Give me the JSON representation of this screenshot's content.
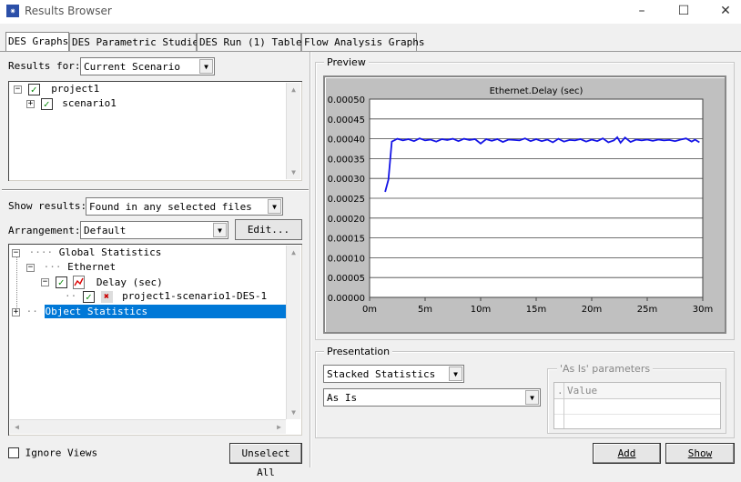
{
  "window": {
    "title": "Results Browser",
    "icon": "star-icon",
    "min": "–",
    "max": "☐",
    "close": "✕"
  },
  "tabs": [
    {
      "label": "DES Graphs"
    },
    {
      "label": "DES Parametric Studies"
    },
    {
      "label": "DES Run (1) Tables"
    },
    {
      "label": "Flow Analysis Graphs"
    }
  ],
  "results_for": {
    "label": "Results for:",
    "value": "Current Scenario"
  },
  "file_tree": [
    {
      "label": "project1",
      "checked": true
    },
    {
      "label": "scenario1",
      "checked": true
    }
  ],
  "show_results": {
    "label": "Show results:",
    "value": "Found in any selected files"
  },
  "arrangement": {
    "label": "Arrangement:",
    "value": "Default",
    "edit_button": "Edit..."
  },
  "stats_tree": [
    {
      "label": "Global Statistics"
    },
    {
      "label": "Ethernet"
    },
    {
      "label": "Delay (sec)"
    },
    {
      "label": "project1-scenario1-DES-1"
    },
    {
      "label": "Object Statistics"
    }
  ],
  "ignore_views": {
    "label": "Ignore Views",
    "checked": false
  },
  "unselect_all": "Unselect All",
  "preview": {
    "title": "Preview"
  },
  "presentation": {
    "title": "Presentation",
    "mode": "Stacked Statistics",
    "filter": "As Is",
    "params_title": "'As Is' parameters",
    "params_header_dot": ".",
    "params_header_value": "Value"
  },
  "buttons": {
    "add": "Add",
    "show": "Show"
  },
  "colors": {
    "accent": "#0078d7",
    "series": "#1414e6",
    "selection": "#0078d7"
  },
  "chart_data": {
    "type": "line",
    "title": "Ethernet.Delay (sec)",
    "xlabel": "",
    "ylabel": "",
    "x_unit": "minutes",
    "xlim": [
      0,
      30
    ],
    "ylim": [
      0,
      0.0005
    ],
    "yticks": [
      "0.00000",
      "0.00005",
      "0.00010",
      "0.00015",
      "0.00020",
      "0.00025",
      "0.00030",
      "0.00035",
      "0.00040",
      "0.00045",
      "0.00050"
    ],
    "xticks": [
      "0m",
      "5m",
      "10m",
      "15m",
      "20m",
      "25m",
      "30m"
    ],
    "grid": true,
    "series": [
      {
        "values": [
          [
            1.4,
            0.000266
          ],
          [
            1.7,
            0.000297
          ],
          [
            2.0,
            0.000393
          ],
          [
            2.5,
            0.0004
          ],
          [
            3.0,
            0.000396
          ],
          [
            3.5,
            0.000399
          ],
          [
            4.0,
            0.000394
          ],
          [
            4.5,
            0.000401
          ],
          [
            5.0,
            0.000396
          ],
          [
            5.5,
            0.000398
          ],
          [
            6.0,
            0.000393
          ],
          [
            6.5,
            0.000399
          ],
          [
            7.0,
            0.000397
          ],
          [
            7.5,
            0.0004
          ],
          [
            8.0,
            0.000394
          ],
          [
            8.5,
            0.0004
          ],
          [
            9.0,
            0.000397
          ],
          [
            9.5,
            0.000399
          ],
          [
            10.0,
            0.000388
          ],
          [
            10.5,
            0.000399
          ],
          [
            11.0,
            0.000395
          ],
          [
            11.5,
            0.000399
          ],
          [
            12.0,
            0.000392
          ],
          [
            12.5,
            0.000398
          ],
          [
            13.0,
            0.000397
          ],
          [
            13.5,
            0.000396
          ],
          [
            14.0,
            0.000401
          ],
          [
            14.5,
            0.000394
          ],
          [
            15.0,
            0.000399
          ],
          [
            15.5,
            0.000394
          ],
          [
            16.0,
            0.000398
          ],
          [
            16.5,
            0.000391
          ],
          [
            17.0,
            0.0004
          ],
          [
            17.5,
            0.000393
          ],
          [
            18.0,
            0.000397
          ],
          [
            18.5,
            0.000396
          ],
          [
            19.0,
            0.000399
          ],
          [
            19.5,
            0.000393
          ],
          [
            20.0,
            0.000398
          ],
          [
            20.5,
            0.000394
          ],
          [
            21.0,
            0.000401
          ],
          [
            21.5,
            0.000391
          ],
          [
            22.0,
            0.000396
          ],
          [
            22.3,
            0.000404
          ],
          [
            22.6,
            0.00039
          ],
          [
            23.0,
            0.000403
          ],
          [
            23.5,
            0.000392
          ],
          [
            24.0,
            0.000398
          ],
          [
            24.5,
            0.000396
          ],
          [
            25.0,
            0.000398
          ],
          [
            25.5,
            0.000395
          ],
          [
            26.0,
            0.000398
          ],
          [
            26.5,
            0.000396
          ],
          [
            27.0,
            0.000397
          ],
          [
            27.5,
            0.000394
          ],
          [
            28.0,
            0.000398
          ],
          [
            28.5,
            0.000401
          ],
          [
            29.0,
            0.000393
          ],
          [
            29.3,
            0.000398
          ],
          [
            29.7,
            0.000391
          ]
        ]
      }
    ]
  }
}
